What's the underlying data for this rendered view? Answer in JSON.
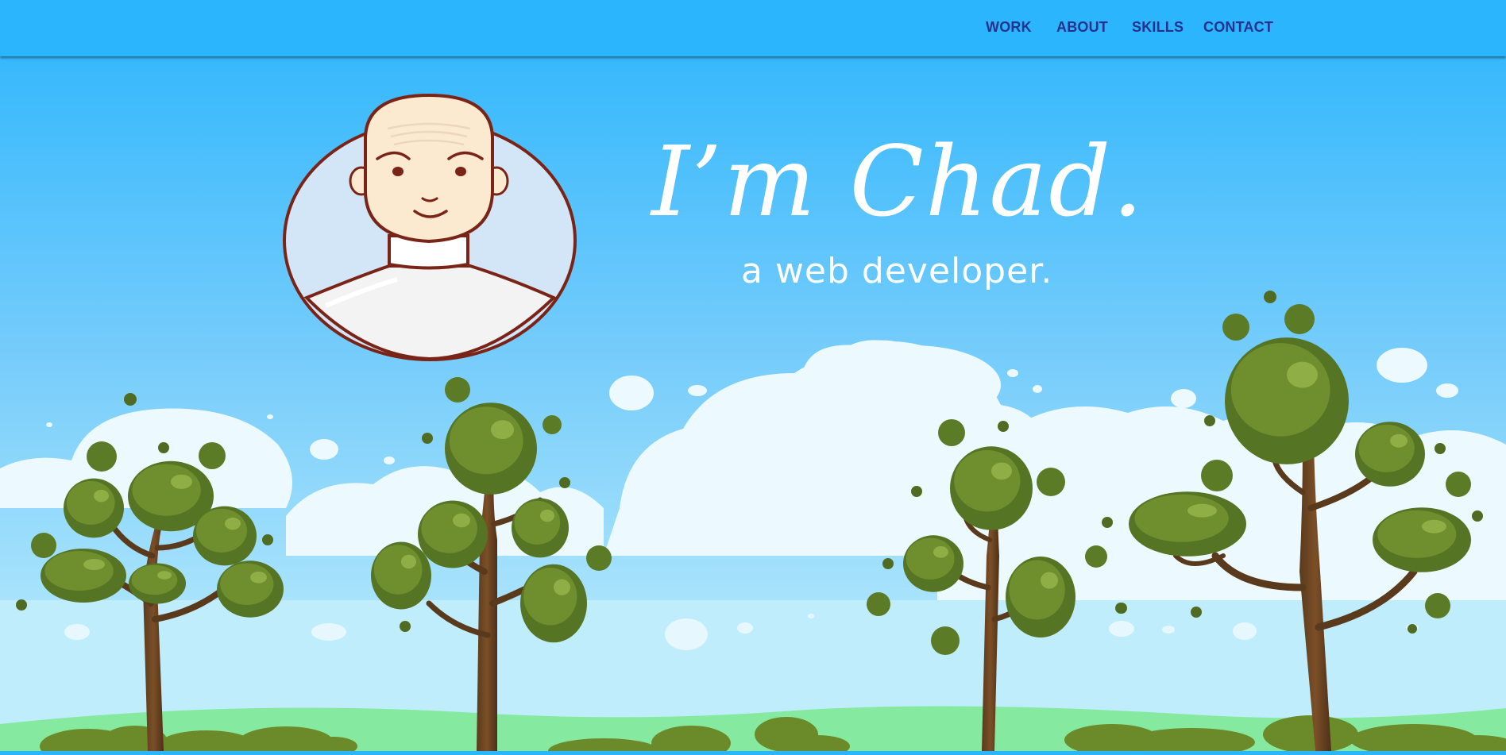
{
  "nav": {
    "items": [
      {
        "label": "WORK"
      },
      {
        "label": "ABOUT"
      },
      {
        "label": "SKILLS"
      },
      {
        "label": "CONTACT"
      }
    ]
  },
  "hero": {
    "title": "I’m Chad.",
    "subtitle": "a web developer."
  },
  "colors": {
    "sky_top": "#2bb5fd",
    "sky_bottom": "#b9ecfb",
    "nav_text": "#26318e",
    "tree_leaf": "#63812a",
    "ground": "#86e9a0"
  },
  "icons": {
    "avatar": "cartoon-bald-man-avatar-icon"
  }
}
